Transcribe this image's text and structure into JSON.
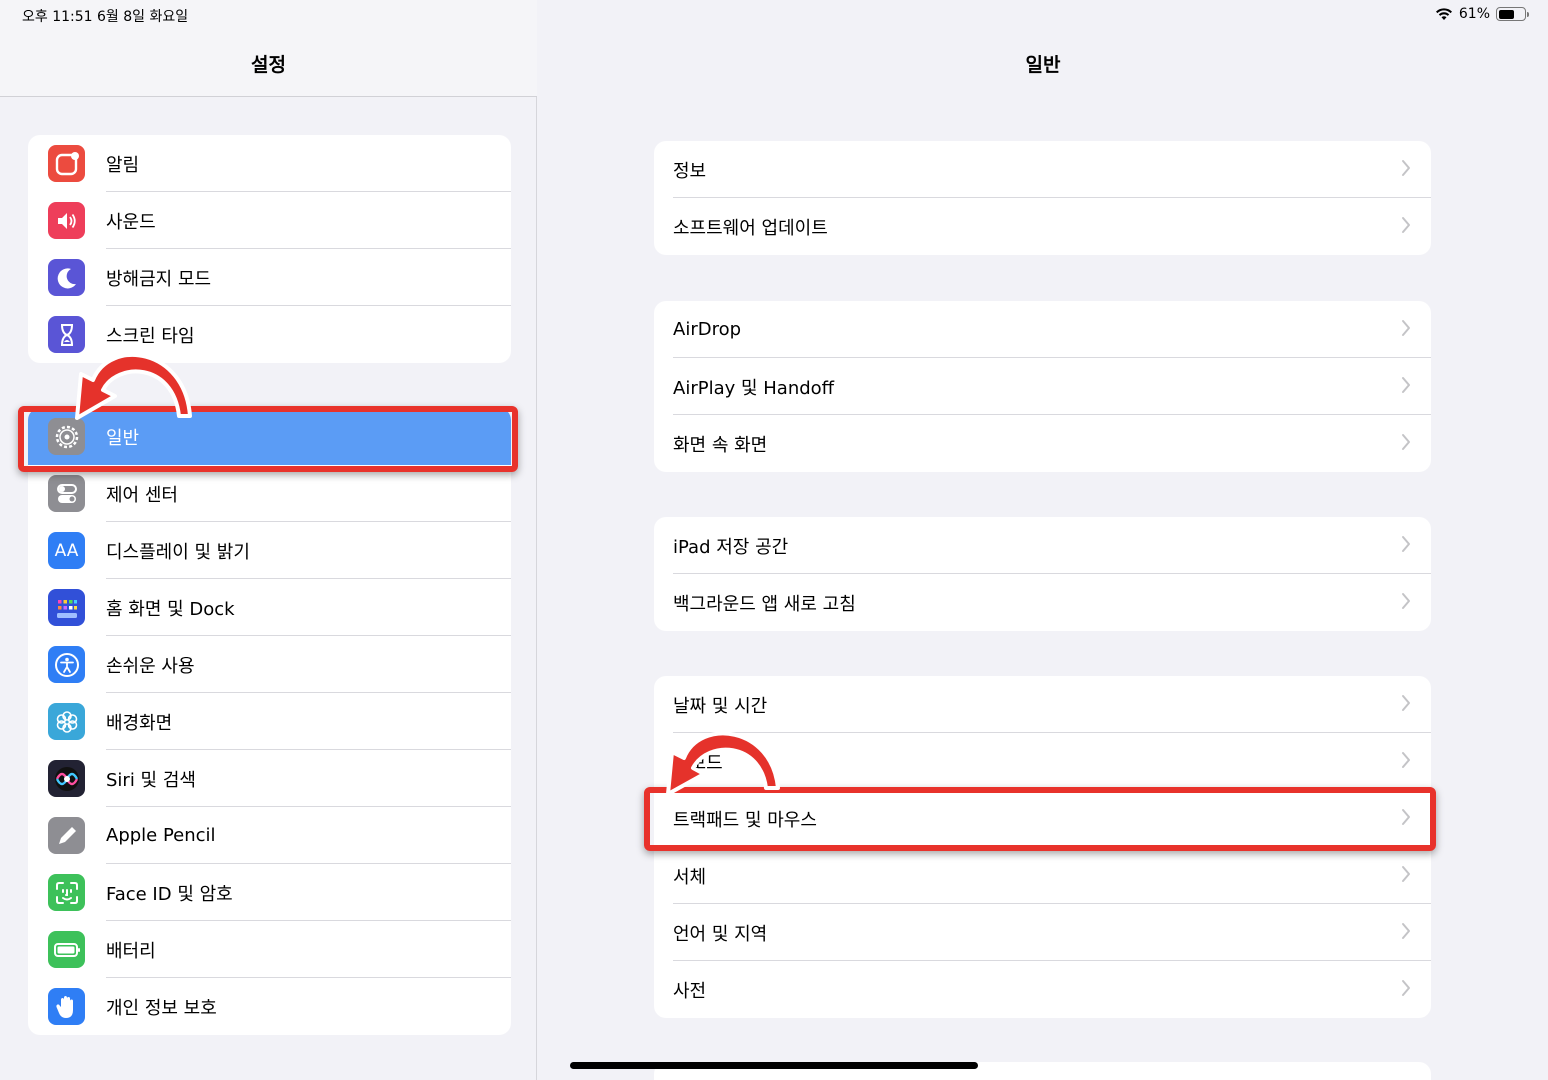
{
  "status": {
    "time": "오후 11:51   6월 8일 화요일",
    "battery": "61%",
    "battery_level": 0.61
  },
  "sidebar": {
    "title": "설정",
    "group1": [
      {
        "label": "알림",
        "icon": "notifications-icon",
        "color": "#ec4b3f"
      },
      {
        "label": "사운드",
        "icon": "sound-icon",
        "color": "#ee3e5a"
      },
      {
        "label": "방해금지 모드",
        "icon": "moon-icon",
        "color": "#5a55d6"
      },
      {
        "label": "스크린 타임",
        "icon": "hourglass-icon",
        "color": "#5a55d6"
      }
    ],
    "group2": [
      {
        "label": "일반",
        "icon": "gear-icon",
        "color": "#8e8e93"
      },
      {
        "label": "제어 센터",
        "icon": "toggles-icon",
        "color": "#8e8e93"
      },
      {
        "label": "디스플레이 및 밝기",
        "icon": "display-icon",
        "color": "#2f7ef5",
        "glyph": "AA"
      },
      {
        "label": "홈 화면 및 Dock",
        "icon": "home-screen-icon",
        "color": "#3150d8"
      },
      {
        "label": "손쉬운 사용",
        "icon": "accessibility-icon",
        "color": "#2f7ef5"
      },
      {
        "label": "배경화면",
        "icon": "wallpaper-icon",
        "color": "#3aa7d9"
      },
      {
        "label": "Siri 및 검색",
        "icon": "siri-icon",
        "color": "#222233"
      },
      {
        "label": "Apple Pencil",
        "icon": "pencil-icon",
        "color": "#8e8e93"
      },
      {
        "label": "Face ID 및 암호",
        "icon": "face-id-icon",
        "color": "#3dc15a"
      },
      {
        "label": "배터리",
        "icon": "battery-icon",
        "color": "#3dc15a"
      },
      {
        "label": "개인 정보 보호",
        "icon": "hand-icon",
        "color": "#2f7ef5"
      }
    ]
  },
  "main": {
    "title": "일반",
    "group1": [
      "정보",
      "소프트웨어 업데이트"
    ],
    "group2": [
      "AirDrop",
      "AirPlay 및 Handoff",
      "화면 속 화면"
    ],
    "group3": [
      "iPad 저장 공간",
      "백그라운드 앱 새로 고침"
    ],
    "group4": [
      "날짜 및 시간",
      "키보드",
      "트랙패드 및 마우스",
      "서체",
      "언어 및 지역",
      "사전"
    ]
  },
  "colors": {
    "highlight": "#e8322b",
    "selected": "#5b9cf5"
  }
}
